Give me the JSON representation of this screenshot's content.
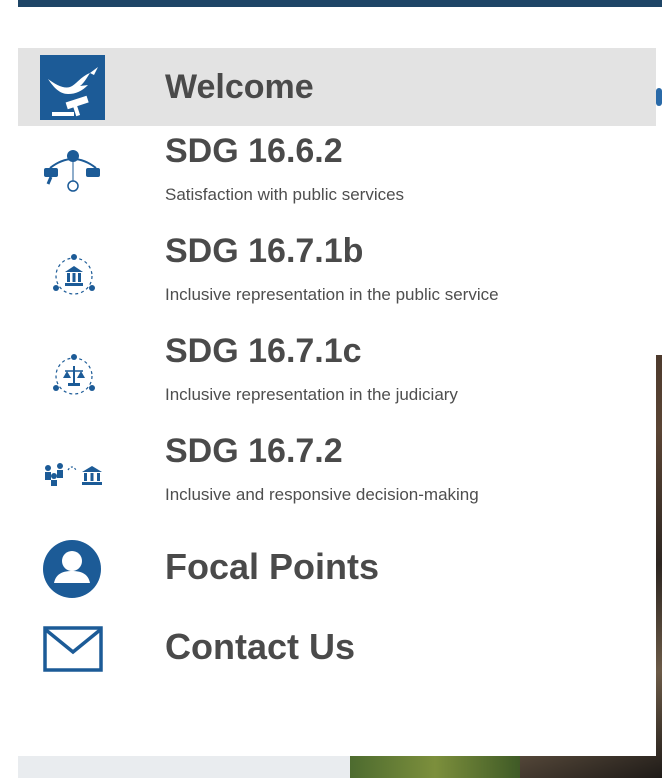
{
  "nav": {
    "welcome": {
      "label": "Welcome",
      "icon": "dove-gavel-icon"
    },
    "items": [
      {
        "title": "SDG 16.6.2",
        "subtitle": "Satisfaction with public services",
        "icon": "public-services-icon"
      },
      {
        "title": "SDG 16.7.1b",
        "subtitle": "Inclusive representation in the public service",
        "icon": "public-service-building-icon"
      },
      {
        "title": "SDG 16.7.1c",
        "subtitle": "Inclusive representation in the judiciary",
        "icon": "judiciary-scales-icon"
      },
      {
        "title": "SDG 16.7.2",
        "subtitle": "Inclusive and responsive decision-making",
        "icon": "decision-making-icon"
      }
    ],
    "focal_points": {
      "label": "Focal Points",
      "icon": "user-circle-icon"
    },
    "contact": {
      "label": "Contact Us",
      "icon": "envelope-icon"
    }
  },
  "colors": {
    "icon_blue": "#1c5b97",
    "header_bar": "#1e4566",
    "active_bg": "#e3e3e3"
  }
}
